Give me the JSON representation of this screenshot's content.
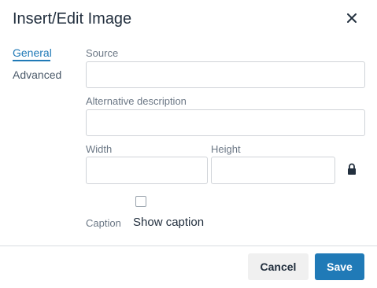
{
  "dialog": {
    "title": "Insert/Edit Image",
    "close_icon": "close-icon"
  },
  "tabs": [
    {
      "label": "General",
      "active": true
    },
    {
      "label": "Advanced",
      "active": false
    }
  ],
  "fields": {
    "source": {
      "label": "Source",
      "value": ""
    },
    "alt": {
      "label": "Alternative description",
      "value": ""
    },
    "width": {
      "label": "Width",
      "value": ""
    },
    "height": {
      "label": "Height",
      "value": ""
    },
    "constrain_icon": "lock-icon",
    "caption": {
      "label": "Caption",
      "checkbox_label": "Show caption",
      "checked": false
    }
  },
  "footer": {
    "cancel_label": "Cancel",
    "save_label": "Save"
  },
  "colors": {
    "accent": "#207ab7",
    "text": "#222f3e",
    "muted": "#6b7785",
    "border": "#cfd3d8"
  }
}
